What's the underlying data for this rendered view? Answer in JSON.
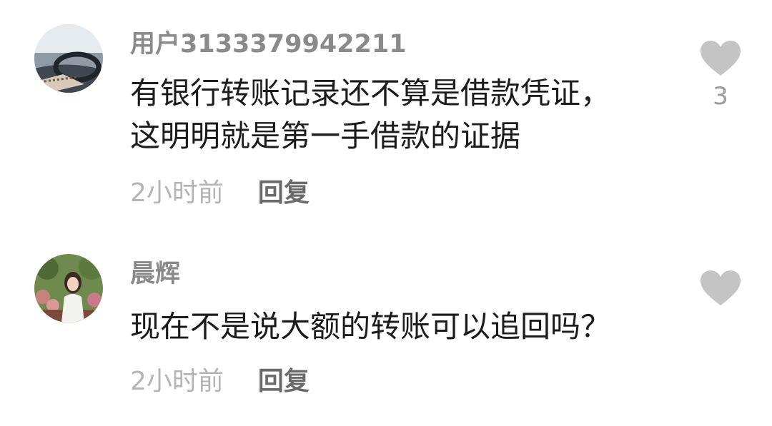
{
  "comments": [
    {
      "username": "用户3133379942211",
      "text_lines": [
        "有银行转账记录还不算是借款凭证，",
        "这明明就是第一手借款的证据"
      ],
      "time": "2小时前",
      "reply_label": "回复",
      "likes": "3",
      "avatar_icon": "avatar-car-photo"
    },
    {
      "username": "晨辉",
      "text_lines": [
        "现在不是说大额的转账可以追回吗？"
      ],
      "time": "2小时前",
      "reply_label": "回复",
      "likes": "",
      "avatar_icon": "avatar-woman-garden-photo"
    }
  ],
  "colors": {
    "username": "#8a8a8a",
    "text": "#1c1c1c",
    "time": "#b4b4b4",
    "reply": "#6a6a6a",
    "heart": "#c4c4c4"
  }
}
